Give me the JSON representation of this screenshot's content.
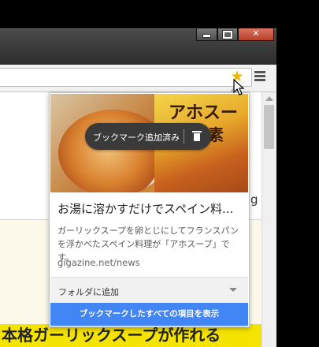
{
  "window": {
    "minimize_glyph": "minimize-icon",
    "maximize_glyph": "maximize-icon",
    "close_glyph": "✕"
  },
  "toolbar": {
    "bookmark_star_icon": "star-icon",
    "menu_icon": "hamburger-menu-icon"
  },
  "bookmark_bubble": {
    "toast_label": "ブックマーク追加済み",
    "title": "お湯に溶かすだけでスペイン料...",
    "description": "ガーリックスープを卵とじにしてフランスパンを浮かべたスペイン料理が「アホスープ」です。",
    "url": "gigazine.net/news",
    "folder_label": "フォルダに追加",
    "show_all_label": "ブックマークしたすべての項目を表示",
    "thumbnail_text_1": "アホスープ",
    "thumbnail_text_2": "素"
  },
  "page": {
    "side_glyph": "g",
    "headline": "本格ガーリックスープが作れる"
  },
  "colors": {
    "star": "#f4b400",
    "primary_button": "#4285f4",
    "headline_bg": "#f5e300"
  }
}
